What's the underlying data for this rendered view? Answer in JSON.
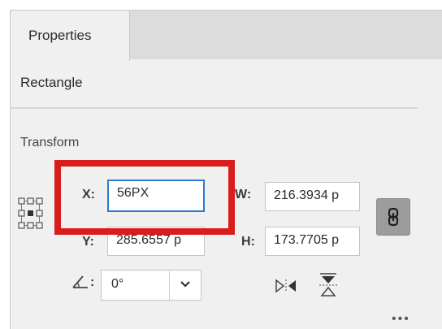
{
  "panel": {
    "tab_label": "Properties",
    "section_title": "Rectangle",
    "subsection_title": "Transform"
  },
  "transform": {
    "x_label": "X:",
    "x_value": "56PX",
    "y_label": "Y:",
    "y_value": "285.6557 p",
    "w_label": "W:",
    "w_value": "216.3934 p",
    "h_label": "H:",
    "h_value": "173.7705 p",
    "angle_label": ":",
    "angle_value": "0°"
  },
  "more_label": "•••",
  "colors": {
    "highlight": "#d91c1c",
    "focus_border": "#2a7bd1",
    "panel_bg": "#f0f0f0",
    "tabbar_bg": "#dcdcdc",
    "link_button_bg": "#9c9c9c"
  },
  "icons": {
    "reference_point": "reference-point-grid-icon",
    "constrain": "link-chain-icon",
    "angle": "angle-icon",
    "dropdown": "chevron-down-icon",
    "flip_horizontal": "flip-horizontal-icon",
    "flip_vertical": "flip-vertical-icon"
  }
}
